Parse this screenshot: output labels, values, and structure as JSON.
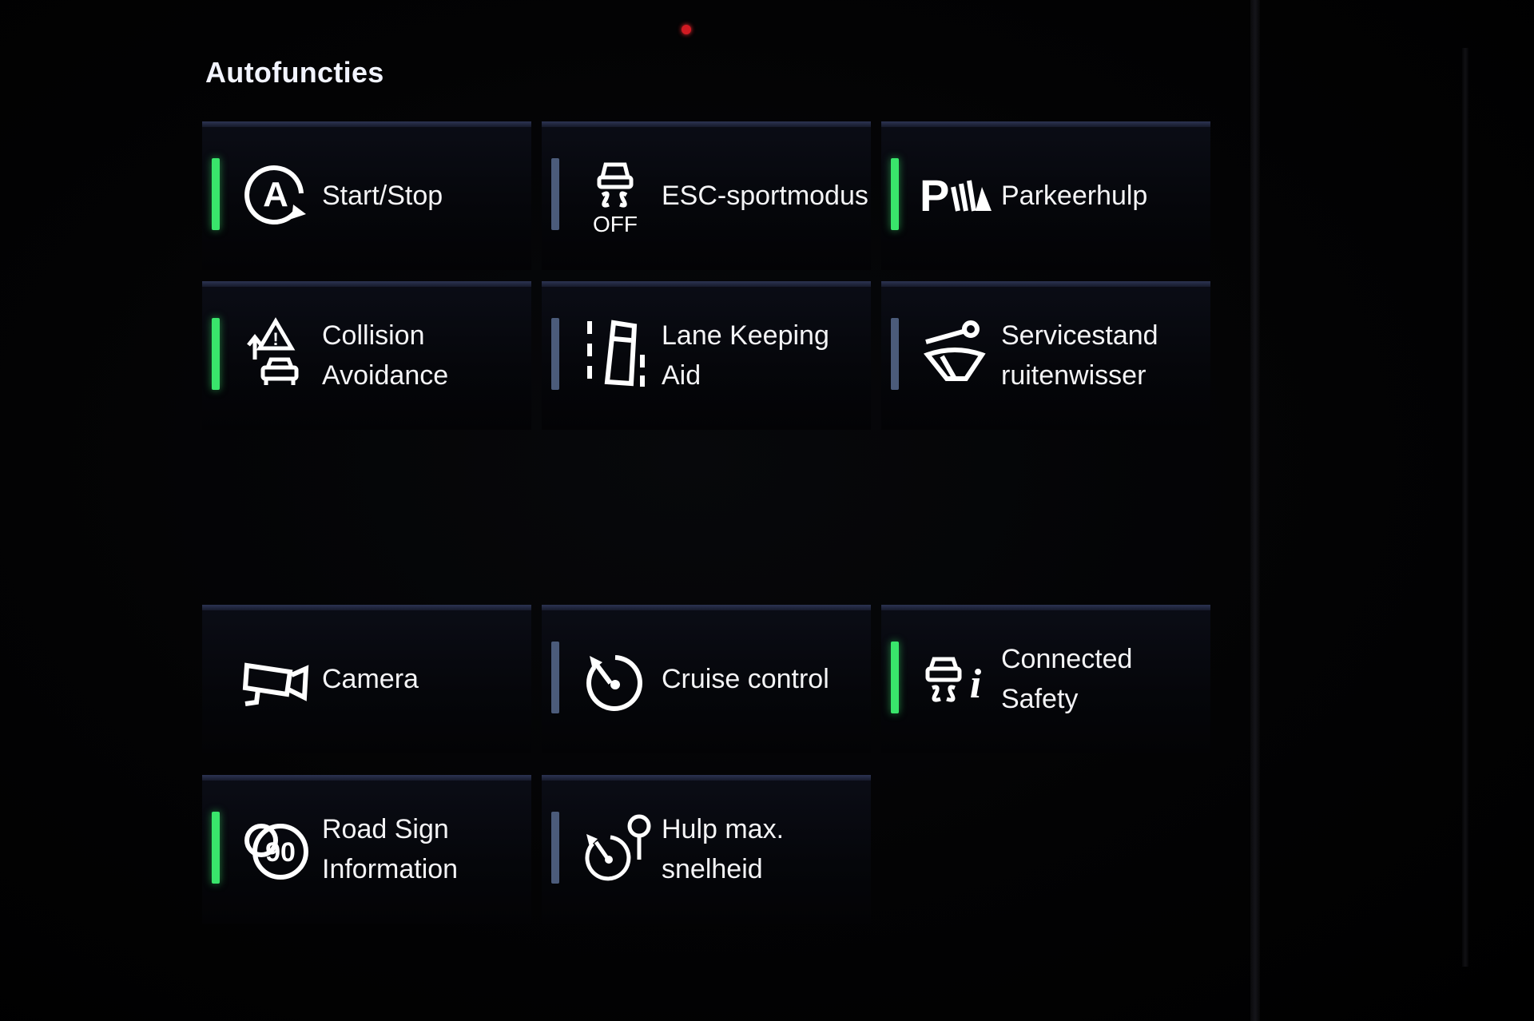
{
  "header": {
    "title": "Autofuncties"
  },
  "tiles": [
    {
      "label": "Start/Stop",
      "icon": "auto-start-stop-icon",
      "state": "on"
    },
    {
      "label": "ESC-sportmodus",
      "icon": "esc-off-icon",
      "state": "off"
    },
    {
      "label": "Parkeerhulp",
      "icon": "park-assist-icon",
      "state": "on"
    },
    {
      "label": "Collision\nAvoidance",
      "icon": "collision-avoidance-icon",
      "state": "on"
    },
    {
      "label": "Lane Keeping\nAid",
      "icon": "lane-keeping-icon",
      "state": "off"
    },
    {
      "label": "Servicestand\nruitenwisser",
      "icon": "wiper-service-icon",
      "state": "off"
    },
    {
      "label": "Camera",
      "icon": "camera-icon",
      "state": "none"
    },
    {
      "label": "Cruise control",
      "icon": "cruise-control-icon",
      "state": "off"
    },
    {
      "label": "Connected\nSafety",
      "icon": "connected-safety-icon",
      "state": "on"
    },
    {
      "label": "Road Sign\nInformation",
      "icon": "road-sign-icon",
      "state": "on"
    },
    {
      "label": "Hulp max.\nsnelheid",
      "icon": "speed-limiter-icon",
      "state": "off"
    }
  ],
  "colors": {
    "indicator_on": "#39e56b",
    "indicator_off": "#4b5b7a",
    "background": "#000000",
    "text": "#f4f4f6"
  }
}
